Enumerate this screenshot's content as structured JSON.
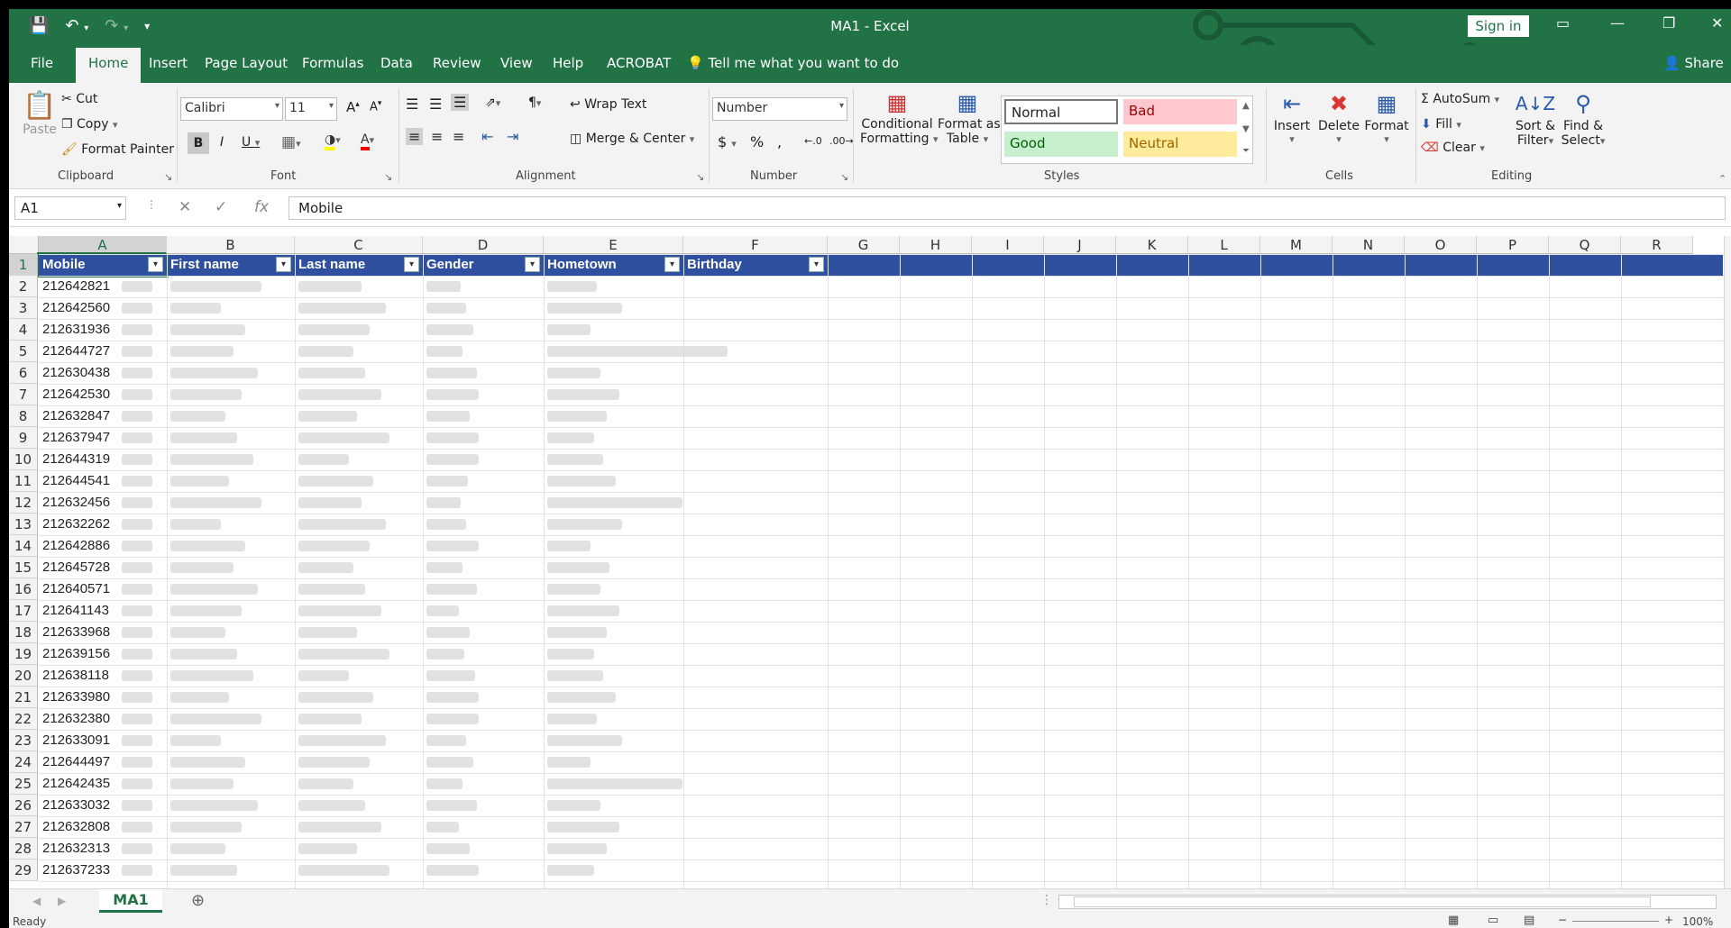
{
  "window": {
    "title": "MA1  -  Excel",
    "sign_in": "Sign in",
    "share": "Share"
  },
  "tabs": [
    "File",
    "Home",
    "Insert",
    "Page Layout",
    "Formulas",
    "Data",
    "Review",
    "View",
    "Help",
    "ACROBAT"
  ],
  "tell_me": "Tell me what you want to do",
  "ribbon": {
    "clipboard": {
      "paste": "Paste",
      "cut": "Cut",
      "copy": "Copy",
      "format_painter": "Format Painter",
      "label": "Clipboard"
    },
    "font": {
      "name": "Calibri",
      "size": "11",
      "label": "Font"
    },
    "alignment": {
      "wrap_text": "Wrap Text",
      "merge_center": "Merge & Center",
      "label": "Alignment"
    },
    "number": {
      "format": "Number",
      "label": "Number"
    },
    "styles": {
      "conditional": "Conditional",
      "conditional2": "Formatting",
      "format_as": "Format as",
      "format_as2": "Table",
      "normal": "Normal",
      "bad": "Bad",
      "good": "Good",
      "neutral": "Neutral",
      "label": "Styles"
    },
    "cells": {
      "insert": "Insert",
      "delete": "Delete",
      "format": "Format",
      "label": "Cells"
    },
    "editing": {
      "autosum": "AutoSum",
      "fill": "Fill",
      "clear": "Clear",
      "sort": "Sort &",
      "sort2": "Filter",
      "find": "Find &",
      "find2": "Select",
      "label": "Editing"
    }
  },
  "formula_bar": {
    "name_box": "A1",
    "content": "Mobile"
  },
  "columns": [
    "A",
    "B",
    "C",
    "D",
    "E",
    "F",
    "G",
    "H",
    "I",
    "J",
    "K",
    "L",
    "M",
    "N",
    "O",
    "P",
    "Q",
    "R"
  ],
  "headers": [
    "Mobile",
    "First name",
    "Last name",
    "Gender",
    "Hometown",
    "Birthday"
  ],
  "rows": [
    {
      "n": "2",
      "mobile": "212642821"
    },
    {
      "n": "3",
      "mobile": "212642560"
    },
    {
      "n": "4",
      "mobile": "212631936"
    },
    {
      "n": "5",
      "mobile": "212644727"
    },
    {
      "n": "6",
      "mobile": "212630438"
    },
    {
      "n": "7",
      "mobile": "212642530"
    },
    {
      "n": "8",
      "mobile": "212632847"
    },
    {
      "n": "9",
      "mobile": "212637947"
    },
    {
      "n": "10",
      "mobile": "212644319"
    },
    {
      "n": "11",
      "mobile": "212644541"
    },
    {
      "n": "12",
      "mobile": "212632456"
    },
    {
      "n": "13",
      "mobile": "212632262"
    },
    {
      "n": "14",
      "mobile": "212642886"
    },
    {
      "n": "15",
      "mobile": "212645728"
    },
    {
      "n": "16",
      "mobile": "212640571"
    },
    {
      "n": "17",
      "mobile": "212641143"
    },
    {
      "n": "18",
      "mobile": "212633968"
    },
    {
      "n": "19",
      "mobile": "212639156"
    },
    {
      "n": "20",
      "mobile": "212638118"
    },
    {
      "n": "21",
      "mobile": "212633980"
    },
    {
      "n": "22",
      "mobile": "212632380"
    },
    {
      "n": "23",
      "mobile": "212633091"
    },
    {
      "n": "24",
      "mobile": "212644497"
    },
    {
      "n": "25",
      "mobile": "212642435"
    },
    {
      "n": "26",
      "mobile": "212633032"
    },
    {
      "n": "27",
      "mobile": "212632808"
    },
    {
      "n": "28",
      "mobile": "212632313"
    },
    {
      "n": "29",
      "mobile": "212637233"
    }
  ],
  "sheet_tab": "MA1",
  "status": {
    "ready": "Ready",
    "zoom": "100%"
  },
  "colors": {
    "excel_green": "#217346",
    "table_header": "#2f4f9f",
    "bad_bg": "#ffc7ce",
    "good_bg": "#c6efce",
    "neutral_bg": "#ffeb9c"
  }
}
